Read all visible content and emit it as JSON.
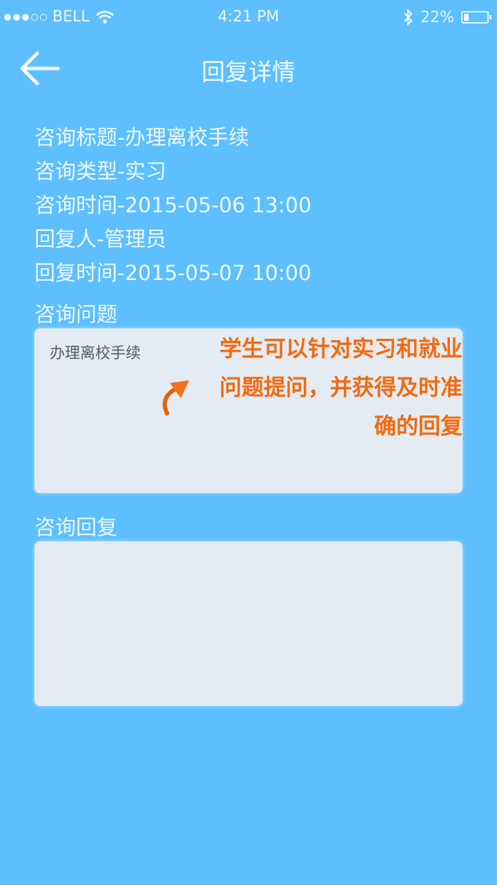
{
  "status_bar": {
    "carrier": "BELL",
    "time": "4:21 PM",
    "battery_percent": "22%",
    "battery_level": 0.22,
    "icons": [
      "signal-dots-icon",
      "wifi-icon",
      "bluetooth-icon",
      "battery-icon"
    ]
  },
  "nav": {
    "back_icon": "arrow-left-icon",
    "title": "回复详情"
  },
  "info": {
    "title_line": "咨询标题-办理离校手续",
    "type_line": "咨询类型-实习",
    "consult_time_line": "咨询时间-2015-05-06  13:00",
    "replier_line": "回复人-管理员",
    "reply_time_line": "回复时间-2015-05-07  10:00"
  },
  "question": {
    "label": "咨询问题",
    "content": "办理离校手续"
  },
  "reply": {
    "label": "咨询回复",
    "content": ""
  },
  "annotation": {
    "text": "学生可以针对实习和就业问题提问，并获得及时准确的回复",
    "color": "#f26a0f",
    "arrow_icon": "curved-arrow-icon"
  },
  "colors": {
    "background": "#5dbffd",
    "box": "#e4ebf2"
  }
}
